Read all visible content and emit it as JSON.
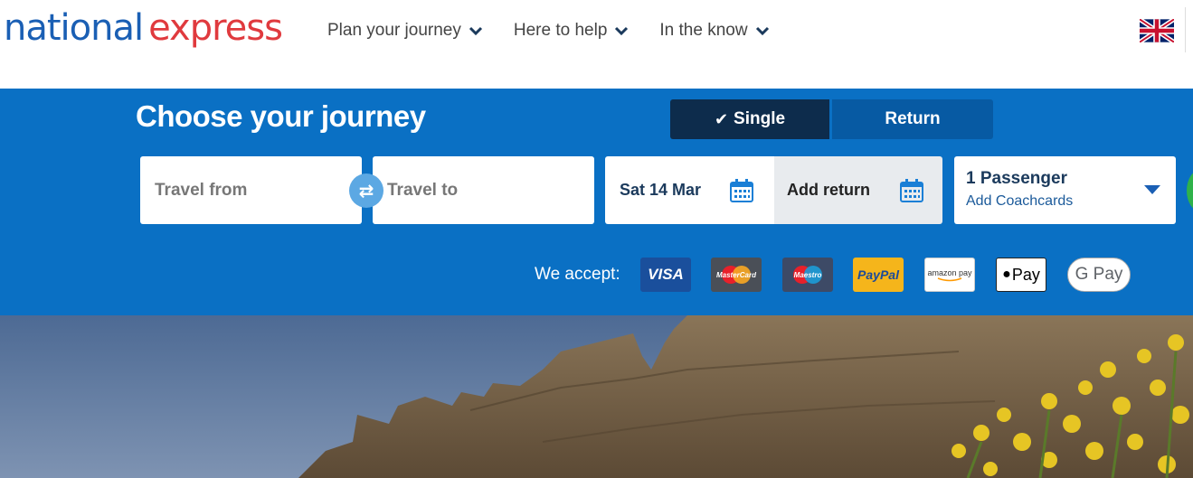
{
  "header": {
    "logo_part1": "national",
    "logo_part2": "express",
    "nav": [
      {
        "label": "Plan your journey"
      },
      {
        "label": "Here to help"
      },
      {
        "label": "In the know"
      }
    ],
    "language_icon": "uk-flag-icon"
  },
  "booking": {
    "title": "Choose your journey",
    "trip_types": {
      "single": "Single",
      "return": "Return",
      "selected": "Single"
    },
    "from_placeholder": "Travel from",
    "to_placeholder": "Travel to",
    "swap_icon": "swap-arrows-icon",
    "outbound_date": "Sat 14 Mar",
    "return_label": "Add return",
    "calendar_icon": "calendar-icon",
    "passengers": "1 Passenger",
    "coachcards": "Add Coachcards"
  },
  "payments": {
    "label": "We accept:",
    "methods": [
      "VISA",
      "MasterCard",
      "Maestro",
      "PayPal",
      "amazon pay",
      "Pay",
      "G Pay"
    ]
  },
  "colors": {
    "band": "#0a70c4",
    "single_active": "#0d2c4c",
    "logo_blue": "#1a5fb4",
    "logo_red": "#e03a3e"
  }
}
